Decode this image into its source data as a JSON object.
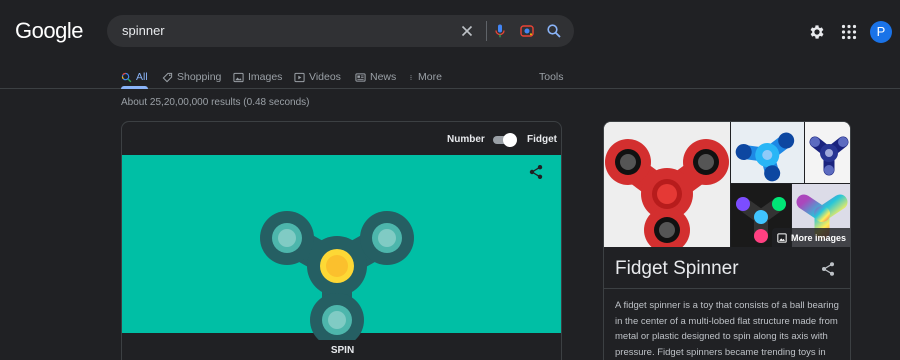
{
  "logo": "Google",
  "search": {
    "query": "spinner",
    "icons": [
      "close-icon",
      "mic-icon",
      "lens-icon",
      "search-icon"
    ]
  },
  "header": {
    "settings_icon": "gear-icon",
    "apps_icon": "apps-grid-icon",
    "avatar_letter": "P"
  },
  "tabs": {
    "all": "All",
    "shopping": "Shopping",
    "images": "Images",
    "videos": "Videos",
    "news": "News",
    "more": "More",
    "tools": "Tools"
  },
  "result_stats": "About 25,20,00,000 results (0.48 seconds)",
  "spinner_card": {
    "toggle_left": "Number",
    "toggle_right": "Fidget",
    "toggle_state": "Fidget",
    "spin_label": "SPIN",
    "stage_color": "#00bfa5",
    "spinner_body_color": "#255f63",
    "spinner_center_color": "#fdd835"
  },
  "knowledge_panel": {
    "more_images": "More images",
    "title": "Fidget Spinner",
    "description": "A fidget spinner is a toy that consists of a ball bearing in the center of a multi-lobed flat structure made from metal or plastic designed to spin along its axis with pressure. Fidget spinners became trending toys in"
  },
  "colors": {
    "background": "#202124",
    "accent": "#8ab4f8",
    "text": "#e8eaed",
    "muted": "#9aa0a6"
  }
}
